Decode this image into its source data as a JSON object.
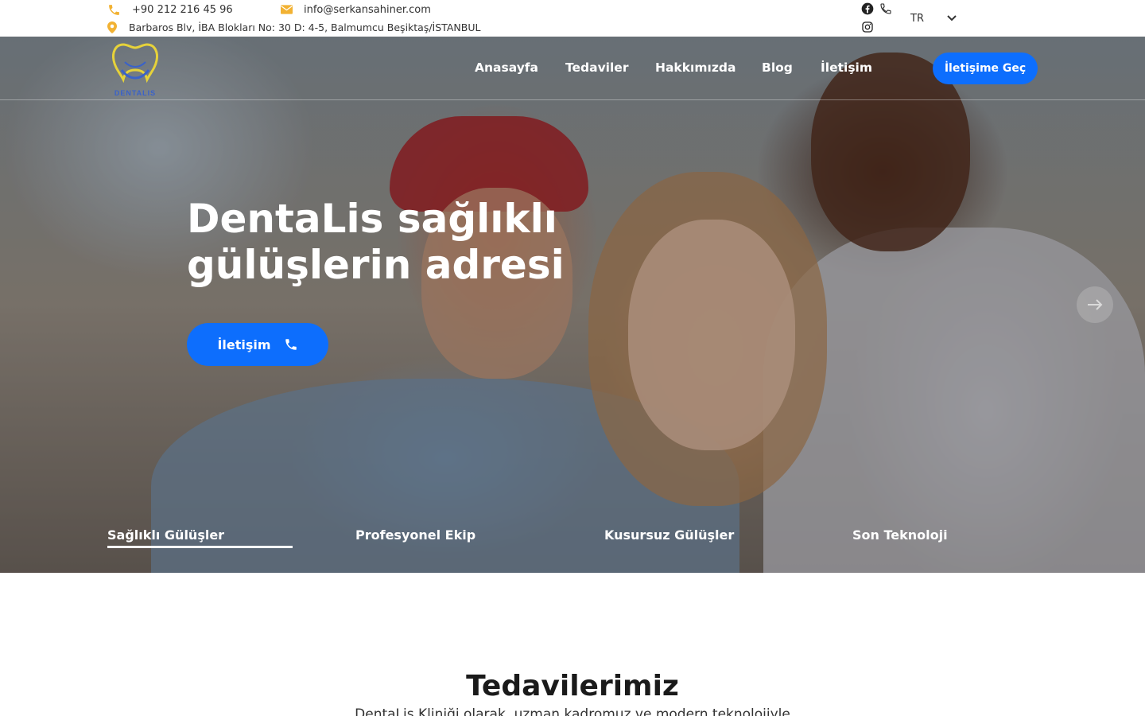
{
  "topbar": {
    "phone": "+90 212 216 45 96",
    "email": "info@serkansahiner.com",
    "address": "Barbaros Blv, İBA Blokları No: 30 D: 4-5, Balmumcu Beşiktaş/İSTANBUL",
    "language": "TR",
    "icon_color": "#f2b233"
  },
  "nav": {
    "links": [
      "Anasayfa",
      "Tedaviler",
      "Hakkımızda",
      "Blog",
      "İletişim"
    ],
    "cta_label": "İletişime Geç",
    "logo_text": "DENTALIS"
  },
  "hero": {
    "title": "DentaLis sağlıklı gülüşlerin adresi",
    "button_label": "İletişim",
    "tabs": [
      "Sağlıklı Gülüşler",
      "Profesyonel Ekip",
      "Kusursuz Gülüşler",
      "Son Teknoloji"
    ],
    "active_tab_index": 0
  },
  "section": {
    "title": "Tedavilerimiz",
    "subtitle": "DentaLis Kliniği olarak, uzman kadromuz ve modern teknolojiyle"
  },
  "colors": {
    "primary": "#0d6efd",
    "accent": "#f2b233"
  }
}
